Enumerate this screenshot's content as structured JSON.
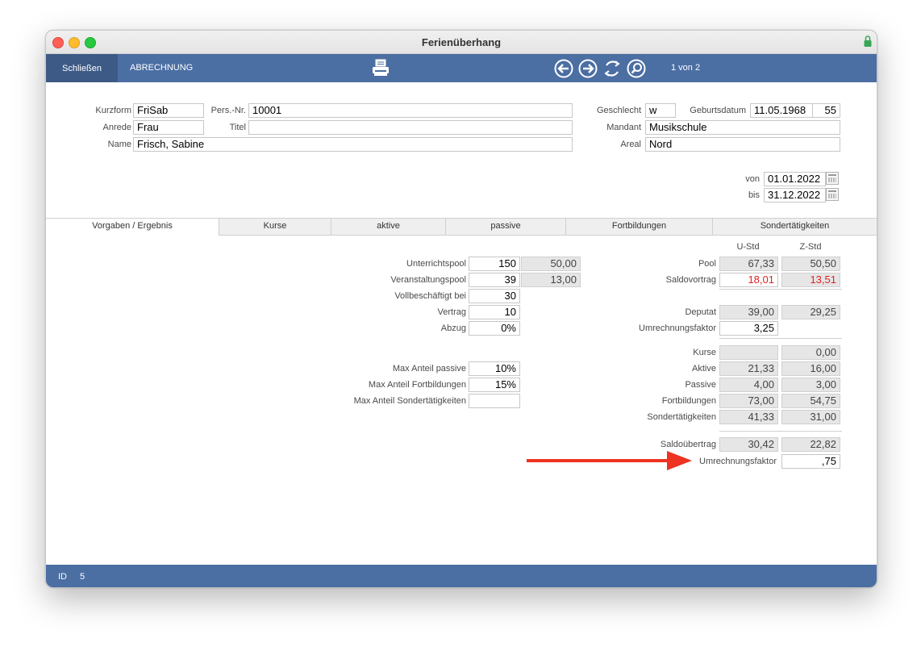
{
  "window": {
    "title": "Ferienüberhang"
  },
  "toolbar": {
    "close_label": "Schließen",
    "abrechnung_label": "ABRECHNUNG",
    "record_count": "1 von 2"
  },
  "header": {
    "kurzform_label": "Kurzform",
    "kurzform": "FriSab",
    "persnr_label": "Pers.-Nr.",
    "persnr": "10001",
    "anrede_label": "Anrede",
    "anrede": "Frau",
    "titel_label": "Titel",
    "titel": "",
    "name_label": "Name",
    "name": "Frisch, Sabine",
    "geschlecht_label": "Geschlecht",
    "geschlecht": "w",
    "geburtsdatum_label": "Geburtsdatum",
    "geburtsdatum": "11.05.1968",
    "alter": "55",
    "mandant_label": "Mandant",
    "mandant": "Musikschule",
    "areal_label": "Areal",
    "areal": "Nord",
    "von_label": "von",
    "von": "01.01.2022",
    "bis_label": "bis",
    "bis": "31.12.2022"
  },
  "tabs": [
    "Vorgaben / Ergebnis",
    "Kurse",
    "aktive",
    "passive",
    "Fortbildungen",
    "Sondertätigkeiten"
  ],
  "left": {
    "unterrichtspool_label": "Unterrichtspool",
    "unterrichtspool": "150",
    "unterrichtspool_calc": "50,00",
    "veranstaltungspool_label": "Veranstaltungspool",
    "veranstaltungspool": "39",
    "veranstaltungspool_calc": "13,00",
    "vollbeschaeftigt_label": "Vollbeschäftigt bei",
    "vollbeschaeftigt": "30",
    "vertrag_label": "Vertrag",
    "vertrag": "10",
    "abzug_label": "Abzug",
    "abzug": "0%",
    "max_passive_label": "Max Anteil passive",
    "max_passive": "10%",
    "max_fortbildungen_label": "Max Anteil Fortbildungen",
    "max_fortbildungen": "15%",
    "max_sonder_label": "Max Anteil Sondertätigkeiten",
    "max_sonder": ""
  },
  "right": {
    "col_u": "U-Std",
    "col_z": "Z-Std",
    "pool_label": "Pool",
    "pool_u": "67,33",
    "pool_z": "50,50",
    "saldovortrag_label": "Saldovortrag",
    "saldovortrag_u": "18,01",
    "saldovortrag_z": "13,51",
    "deputat_label": "Deputat",
    "deputat_u": "39,00",
    "deputat_z": "29,25",
    "umrechnung1_label": "Umrechnungsfaktor",
    "umrechnung1": "3,25",
    "kurse_label": "Kurse",
    "kurse_u": "",
    "kurse_z": "0,00",
    "aktive_label": "Aktive",
    "aktive_u": "21,33",
    "aktive_z": "16,00",
    "passive_label": "Passive",
    "passive_u": "4,00",
    "passive_z": "3,00",
    "fortbildungen_label": "Fortbildungen",
    "fortbildungen_u": "73,00",
    "fortbildungen_z": "54,75",
    "sonder_label": "Sondertätigkeiten",
    "sonder_u": "41,33",
    "sonder_z": "31,00",
    "saldouebertrag_label": "Saldoübertrag",
    "saldouebertrag_u": "30,42",
    "saldouebertrag_z": "22,82",
    "umrechnung2_label": "Umrechnungsfaktor",
    "umrechnung2": ",75"
  },
  "footer": {
    "id_label": "ID",
    "id_value": "5"
  },
  "colors": {
    "toolbar": "#4b6ea3",
    "close_button": "#3d5a86",
    "red_value": "#dd2222",
    "arrow": "#ee3322"
  },
  "icons": [
    "printer-icon",
    "arrow-left-icon",
    "arrow-right-icon",
    "refresh-icon",
    "search-icon",
    "calendar-icon",
    "lock-icon"
  ]
}
